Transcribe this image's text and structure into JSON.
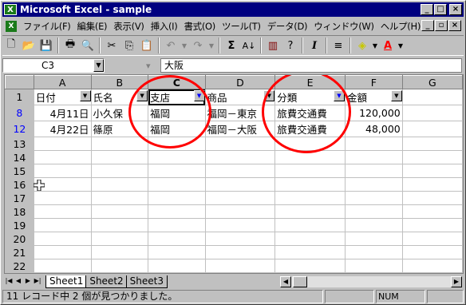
{
  "window": {
    "title": "Microsoft Excel - sample"
  },
  "menu": [
    "ファイル(F)",
    "編集(E)",
    "表示(V)",
    "挿入(I)",
    "書式(O)",
    "ツール(T)",
    "データ(D)",
    "ウィンドウ(W)",
    "ヘルプ(H)"
  ],
  "formula": {
    "name_box": "C3",
    "content": "大阪"
  },
  "columns": [
    "A",
    "B",
    "C",
    "D",
    "E",
    "F",
    "G"
  ],
  "header_row": {
    "number": "1",
    "cells": [
      "日付",
      "氏名",
      "支店",
      "商品",
      "分類",
      "金額"
    ]
  },
  "rows": [
    {
      "number": "8",
      "filtered": true,
      "cells": [
        "4月11日",
        "小久保",
        "福岡",
        "福岡－東京",
        "旅費交通費",
        "120,000"
      ]
    },
    {
      "number": "12",
      "filtered": true,
      "cells": [
        "4月22日",
        "篠原",
        "福岡",
        "福岡－大阪",
        "旅費交通費",
        "48,000"
      ]
    },
    {
      "number": "13",
      "filtered": false,
      "cells": [
        "",
        "",
        "",
        "",
        "",
        ""
      ]
    },
    {
      "number": "14",
      "filtered": false,
      "cells": [
        "",
        "",
        "",
        "",
        "",
        ""
      ]
    },
    {
      "number": "15",
      "filtered": false,
      "cells": [
        "",
        "",
        "",
        "",
        "",
        ""
      ]
    },
    {
      "number": "16",
      "filtered": false,
      "cells": [
        "",
        "",
        "",
        "",
        "",
        ""
      ]
    },
    {
      "number": "17",
      "filtered": false,
      "cells": [
        "",
        "",
        "",
        "",
        "",
        ""
      ]
    },
    {
      "number": "18",
      "filtered": false,
      "cells": [
        "",
        "",
        "",
        "",
        "",
        ""
      ]
    },
    {
      "number": "19",
      "filtered": false,
      "cells": [
        "",
        "",
        "",
        "",
        "",
        ""
      ]
    },
    {
      "number": "20",
      "filtered": false,
      "cells": [
        "",
        "",
        "",
        "",
        "",
        ""
      ]
    },
    {
      "number": "21",
      "filtered": false,
      "cells": [
        "",
        "",
        "",
        "",
        "",
        ""
      ]
    },
    {
      "number": "22",
      "filtered": false,
      "cells": [
        "",
        "",
        "",
        "",
        "",
        ""
      ]
    }
  ],
  "sheets": [
    "Sheet1",
    "Sheet2",
    "Sheet3"
  ],
  "status": {
    "message": "11 レコード中 2 個が見つかりました。",
    "num": "NUM"
  },
  "colors": {
    "title_bar": "#000080",
    "highlight_circle": "#ff0000",
    "filtered_row_number": "#0000ff"
  }
}
